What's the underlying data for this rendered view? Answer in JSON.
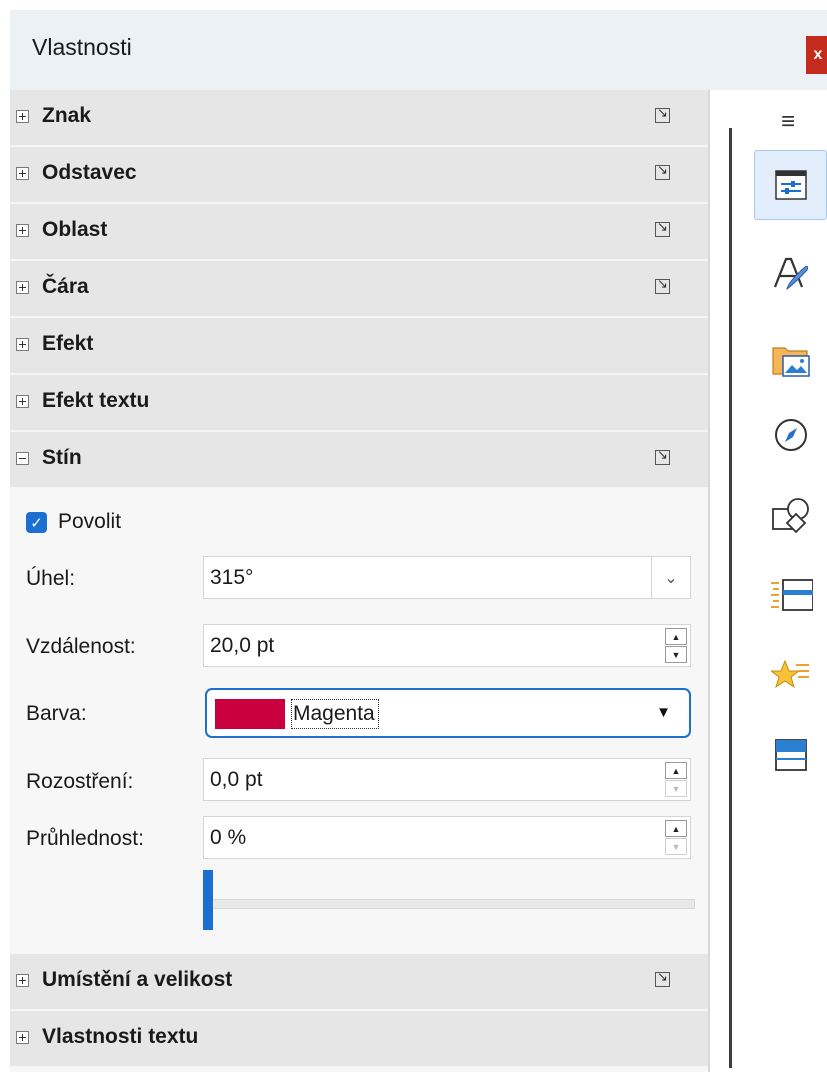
{
  "window": {
    "title": "Vlastnosti",
    "close_label": "x"
  },
  "sections_top": [
    {
      "label": "Znak",
      "expanded": false,
      "has_more": true
    },
    {
      "label": "Odstavec",
      "expanded": false,
      "has_more": true
    },
    {
      "label": "Oblast",
      "expanded": false,
      "has_more": true
    },
    {
      "label": "Čára",
      "expanded": false,
      "has_more": true
    },
    {
      "label": "Efekt",
      "expanded": false,
      "has_more": false
    },
    {
      "label": "Efekt textu",
      "expanded": false,
      "has_more": false
    },
    {
      "label": "Stín",
      "expanded": true,
      "has_more": true
    }
  ],
  "shadow": {
    "enable_label": "Povolit",
    "enabled": true,
    "angle": {
      "label": "Úhel:",
      "value": "315°"
    },
    "distance": {
      "label": "Vzdálenost:",
      "value": "20,0 pt"
    },
    "color": {
      "label": "Barva:",
      "value": "Magenta",
      "swatch": "#c9003d"
    },
    "blur": {
      "label": "Rozostření:",
      "value": "0,0 pt"
    },
    "transparency": {
      "label": "Průhlednost:",
      "value": "0 %",
      "slider_fraction": 0
    }
  },
  "sections_bottom": [
    {
      "label": "Umístění a velikost",
      "expanded": false,
      "has_more": true
    },
    {
      "label": "Vlastnosti textu",
      "expanded": false,
      "has_more": false
    }
  ],
  "tabbar": {
    "menu_icon": "hamburger-menu-icon",
    "tabs": [
      {
        "icon": "properties-icon",
        "active": true
      },
      {
        "icon": "styles-icon",
        "active": false
      },
      {
        "icon": "gallery-icon",
        "active": false
      },
      {
        "icon": "navigator-icon",
        "active": false
      },
      {
        "icon": "shapes-icon",
        "active": false
      },
      {
        "icon": "slide-transition-icon",
        "active": false
      },
      {
        "icon": "animation-icon",
        "active": false
      },
      {
        "icon": "master-slides-icon",
        "active": false
      }
    ]
  },
  "colors": {
    "accent": "#1a6fd0",
    "close": "#c42b1c",
    "swatch": "#c9003d"
  }
}
